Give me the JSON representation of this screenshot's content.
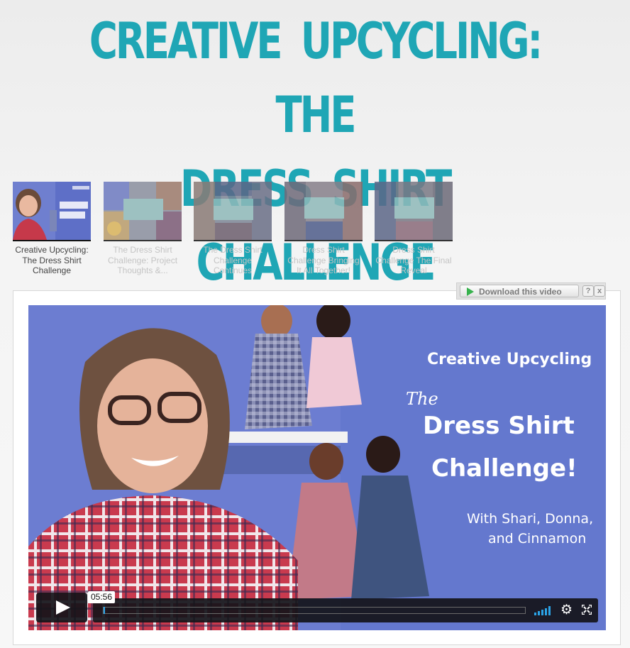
{
  "page": {
    "title": "CREATIVE UPCYCLING: THE DRESS SHIRT CHALLENGE",
    "title_line1": "CREATIVE UPCYCLING: THE",
    "title_line2": "DRESS SHIRT CHALLENGE",
    "accent_color": "#1fa6b5"
  },
  "playlist": {
    "items": [
      {
        "caption": "Creative Upcycling: The Dress Shirt Challenge",
        "active": true
      },
      {
        "caption": "The Dress Shirt Challenge: Project Thoughts &...",
        "active": false
      },
      {
        "caption": "The Dress Shirt Challenge Continues",
        "active": false
      },
      {
        "caption": "Dress Shirt Challenge Bringing It All Together!",
        "active": false
      },
      {
        "caption": "Dress Shirt Challenge The Final Reveal",
        "active": false
      }
    ]
  },
  "download_bar": {
    "label": "Download this video",
    "help": "?",
    "close": "x"
  },
  "video": {
    "overlay_line1": "Creative Upcycling",
    "overlay_the": "The",
    "overlay_line2": "Dress Shirt",
    "overlay_line3": "Challenge!",
    "overlay_line4": "With Shari, Donna,",
    "overlay_line5": "and Cinnamon",
    "duration": "05:56",
    "progress_fraction": 0.0,
    "icons": [
      "play-icon",
      "volume-icon",
      "gear-icon",
      "fullscreen-icon"
    ],
    "progress_color": "#2ba3e6"
  }
}
